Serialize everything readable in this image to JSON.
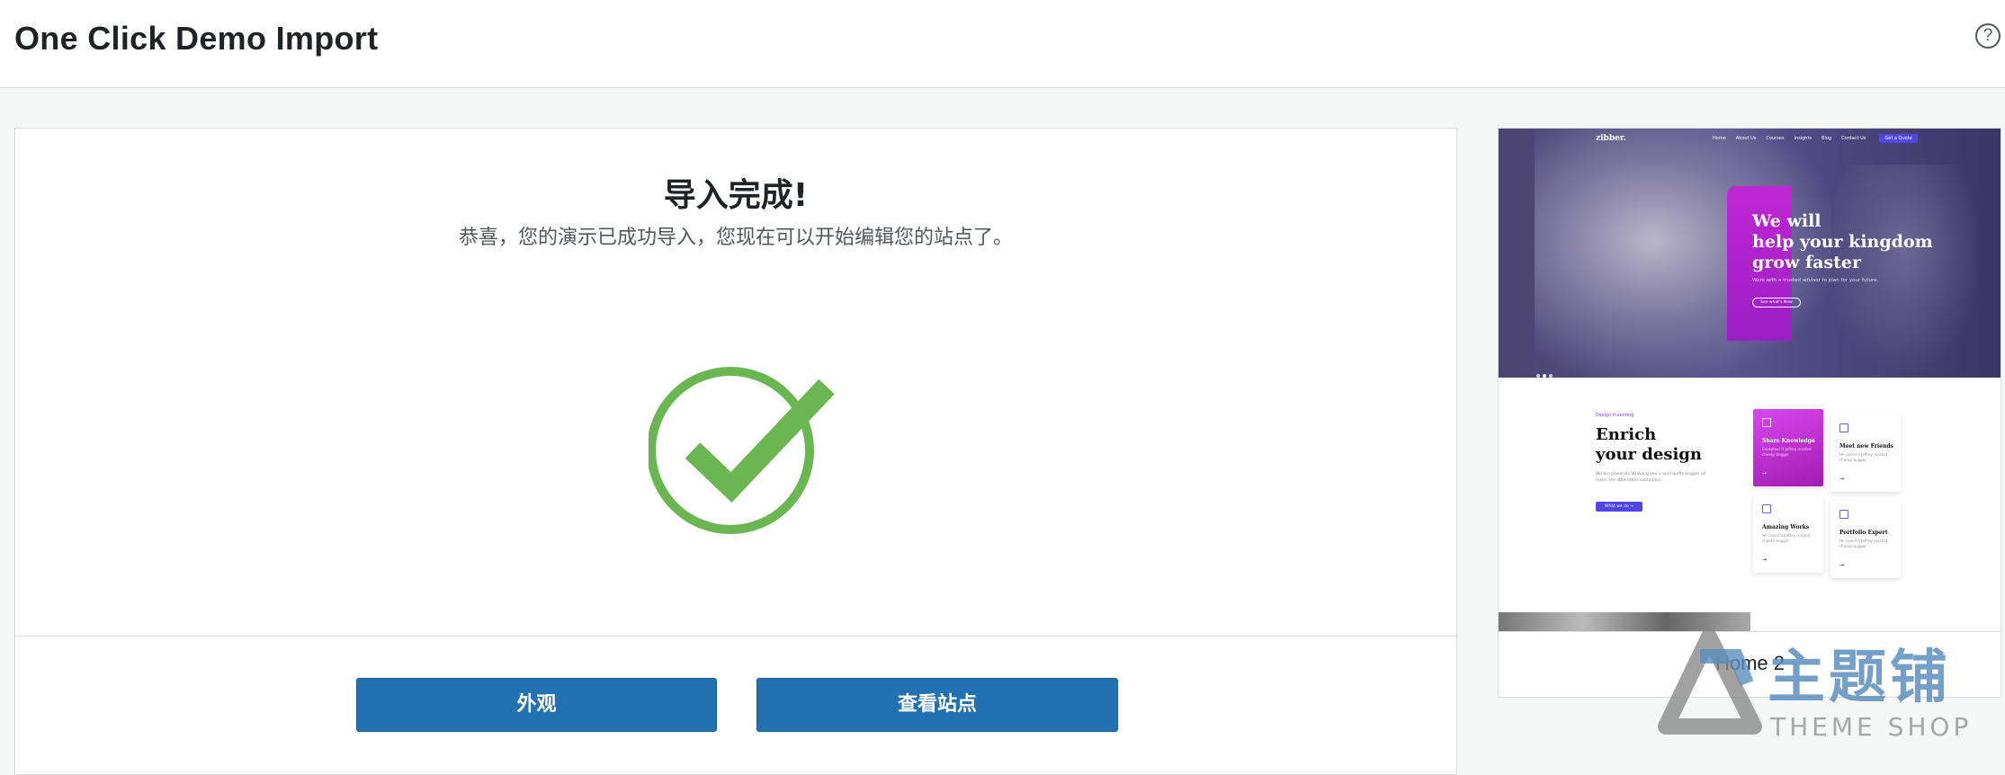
{
  "header": {
    "title": "One Click Demo Import",
    "help_icon": "?"
  },
  "result": {
    "heading": "导入完成!",
    "message": "恭喜，您的演示已成功导入，您现在可以开始编辑您的站点了。",
    "status_icon": "check-circle-icon",
    "success_color": "#6ab650"
  },
  "actions": {
    "appearance_label": "外观",
    "view_site_label": "查看站点",
    "button_color": "#2271b1"
  },
  "preview": {
    "name": "Home 2",
    "screenshot": {
      "brand": "zibber.",
      "nav": [
        "Home",
        "About Us",
        "Courses",
        "Insights",
        "Blog",
        "Contact Us"
      ],
      "nav_cta": "Get a Quote",
      "hero_title_lines": [
        "We will",
        "help your kingdom",
        "grow faster"
      ],
      "hero_sub": "Work with a trusted advisor to plan for your future.",
      "hero_btn": "See what's New",
      "section_tag": "Design Inventing",
      "section_title_lines": [
        "Enrich",
        "your design"
      ],
      "section_text": "We are placerats Wriwang jelu a quid quiffy bugger all mate, the little rotter nosta plus.",
      "section_btn": "What we do  →",
      "cards": [
        {
          "title": "Share Knowledge",
          "desc": "Excepteur it Jeffrey mosted cheeky bugger.",
          "arrow": "→"
        },
        {
          "title": "Meet new Friends",
          "desc": "He raised it Jeffrey mosted cheeky bugger.",
          "arrow": "→"
        },
        {
          "title": "Amazing Works",
          "desc": "He raised it Jeffrey mosted cheeky bugger.",
          "arrow": "→"
        },
        {
          "title": "Portfolio Expert",
          "desc": "He raised it Jeffrey mosted cheeky bugger.",
          "arrow": "→"
        }
      ]
    }
  },
  "watermark": {
    "text": "主题铺",
    "sub": "THEME SHOP"
  }
}
